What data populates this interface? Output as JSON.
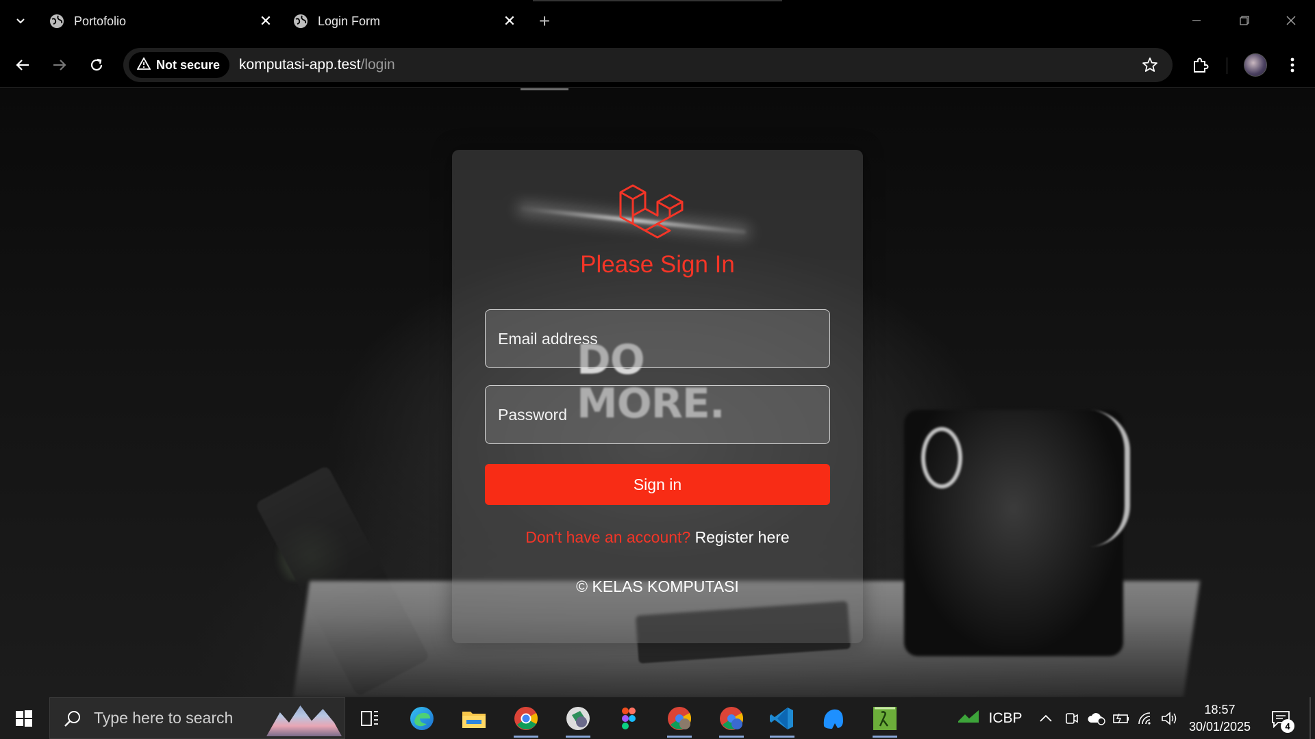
{
  "browser": {
    "tabs": [
      {
        "title": "Portofolio",
        "active": false
      },
      {
        "title": "Login Form",
        "active": true
      }
    ],
    "close_glyph": "✕",
    "new_tab_glyph": "+",
    "security_label": "Not secure",
    "url_host": "komputasi-app.test",
    "url_path": "/login"
  },
  "background_text": {
    "line1": "DO",
    "line2": "MORE."
  },
  "login": {
    "title": "Please Sign In",
    "email_placeholder": "Email address",
    "password_placeholder": "Password",
    "signin_label": "Sign in",
    "register_prompt": "Don't have an account?",
    "register_link": "Register here",
    "copyright": "© KELAS KOMPUTASI",
    "accent_color": "#f43527",
    "button_color": "#f82c15"
  },
  "taskbar": {
    "search_placeholder": "Type here to search",
    "apps": [
      "task-view",
      "edge",
      "file-explorer",
      "chrome",
      "chrome-profile",
      "figma",
      "chrome-profile-2",
      "chrome-profile-3",
      "vscode",
      "app-blue",
      "app-lambda"
    ],
    "stock_ticker": "ICBP",
    "time": "18:57",
    "date": "30/01/2025",
    "notification_count": "4"
  }
}
